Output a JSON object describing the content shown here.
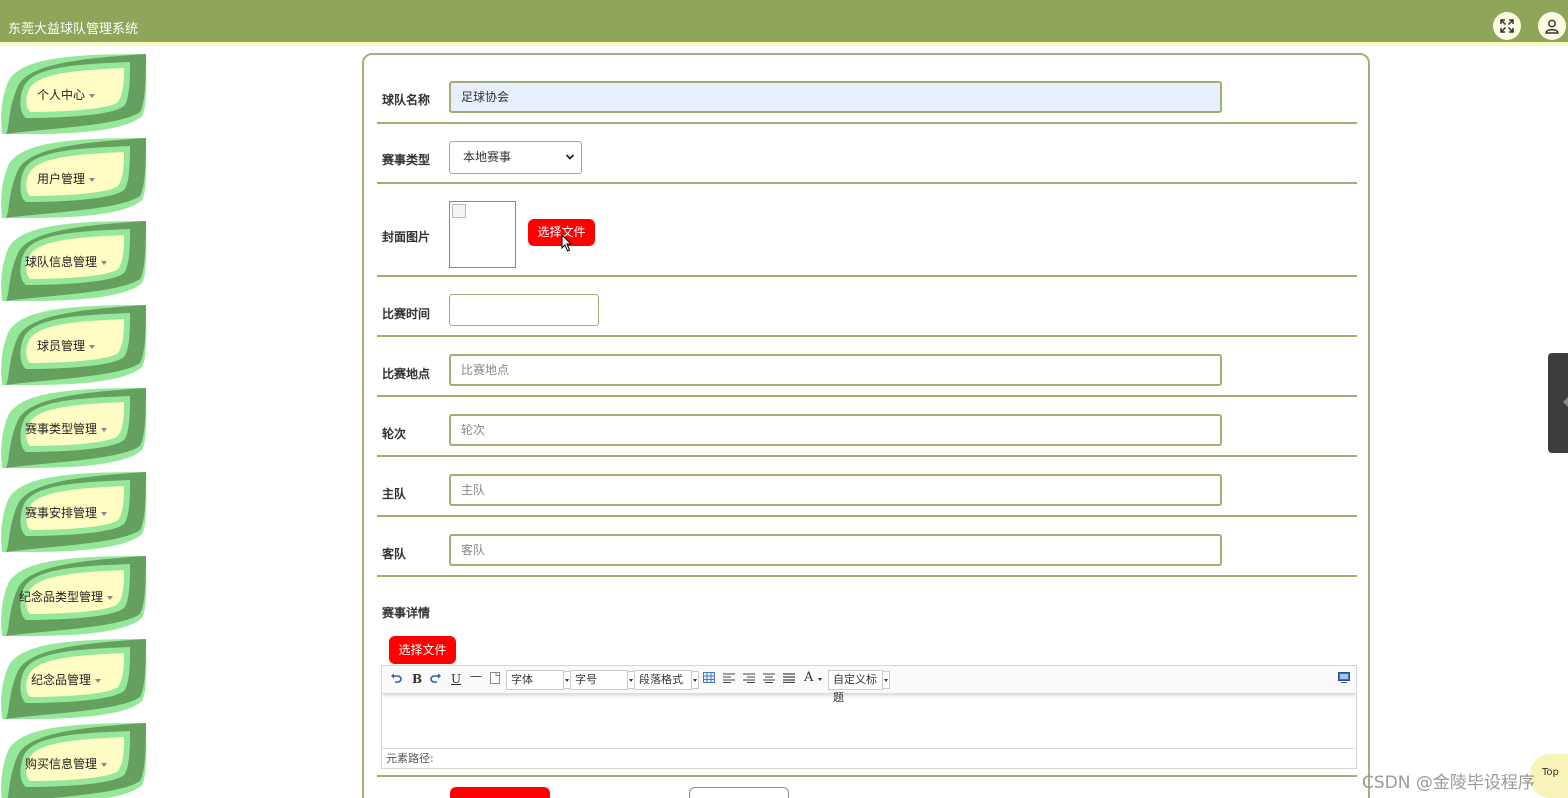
{
  "header": {
    "title": "东莞大益球队管理系统",
    "expand_icon": "expand-icon",
    "user_icon": "user-icon"
  },
  "sidebar": {
    "items": [
      {
        "label": "个人中心"
      },
      {
        "label": "用户管理"
      },
      {
        "label": "球队信息管理"
      },
      {
        "label": "球员管理"
      },
      {
        "label": "赛事类型管理"
      },
      {
        "label": "赛事安排管理"
      },
      {
        "label": "纪念品类型管理"
      },
      {
        "label": "纪念品管理"
      },
      {
        "label": "购买信息管理"
      }
    ]
  },
  "form": {
    "team_name": {
      "label": "球队名称",
      "value": "足球协会"
    },
    "event_type": {
      "label": "赛事类型",
      "value": "本地赛事"
    },
    "cover_image": {
      "label": "封面图片",
      "upload_label": "选择文件"
    },
    "match_time": {
      "label": "比赛时间",
      "value": ""
    },
    "match_location": {
      "label": "比赛地点",
      "placeholder": "比赛地点"
    },
    "round": {
      "label": "轮次",
      "placeholder": "轮次"
    },
    "home_team": {
      "label": "主队",
      "placeholder": "主队"
    },
    "away_team": {
      "label": "客队",
      "placeholder": "客队"
    },
    "event_details": {
      "label": "赛事详情",
      "upload_label": "选择文件"
    }
  },
  "editor": {
    "font_combo": "字体",
    "size_combo": "字号",
    "paragraph_combo": "段落格式",
    "custom_title_combo": "自定义标题",
    "status_path": "元素路径:"
  },
  "overlay": {
    "watermark": "CSDN @金陵毕设程序",
    "top_label": "Top"
  },
  "colors": {
    "header_bg": "#8fa65a",
    "accent_red": "#ff0000",
    "border_olive": "#a3ad74",
    "menu_green_light": "#95e89a",
    "menu_green_dark": "#66a05e",
    "menu_inner": "#fffcc4"
  }
}
